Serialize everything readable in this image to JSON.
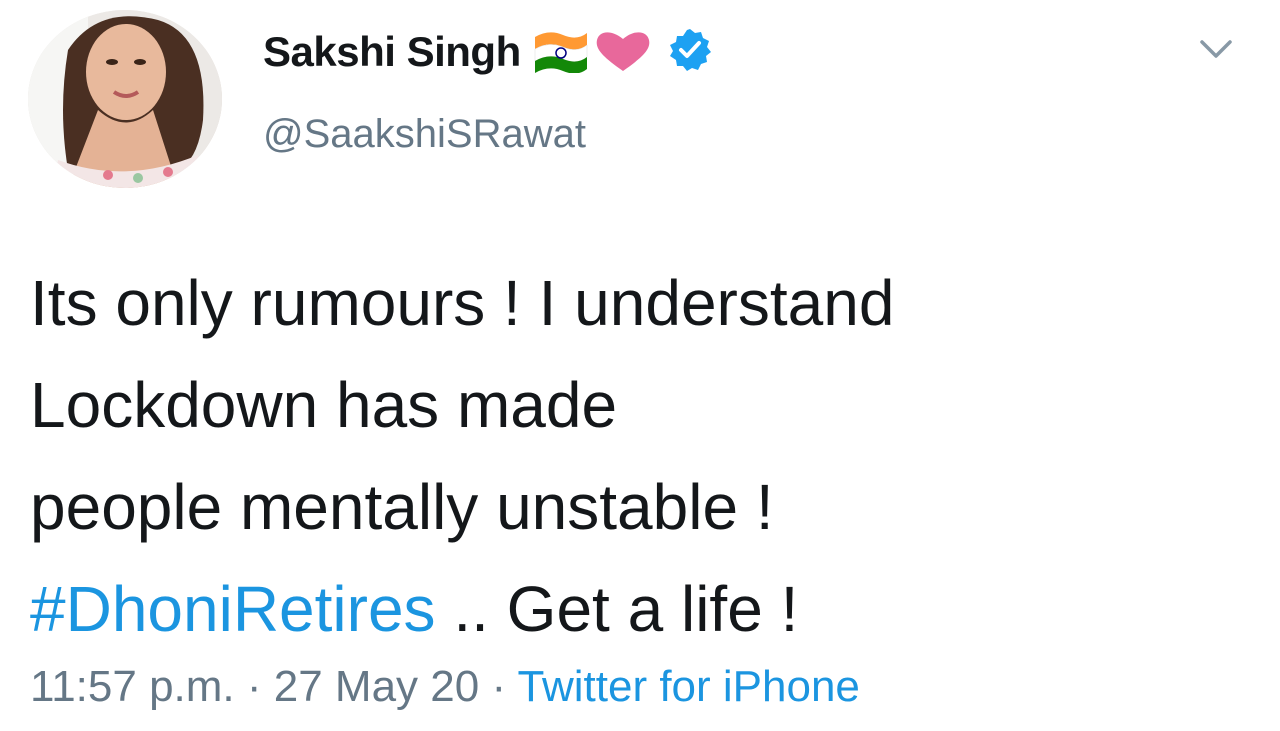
{
  "user": {
    "display_name": "Sakshi Singh",
    "handle": "@SaakshiSRawat",
    "name_emojis": [
      "india-flag-emoji",
      "pink-heart-emoji"
    ],
    "verified": true
  },
  "tweet": {
    "lines": [
      "Its only rumours ! I understand",
      "Lockdown has made",
      "people mentally unstable !"
    ],
    "hashtag": "#DhoniRetires",
    "after_hashtag": " .. Get a life !"
  },
  "footer": {
    "time": "11:57 p.m.",
    "separator": " · ",
    "date": "27 May 20",
    "source": "Twitter for iPhone"
  },
  "colors": {
    "link": "#1b95e0",
    "verified": "#1da1f2",
    "secondary_text": "#657786",
    "primary_text": "#14171a"
  },
  "icons": {
    "menu": "chevron-down-icon",
    "verified": "verified-badge-icon"
  }
}
